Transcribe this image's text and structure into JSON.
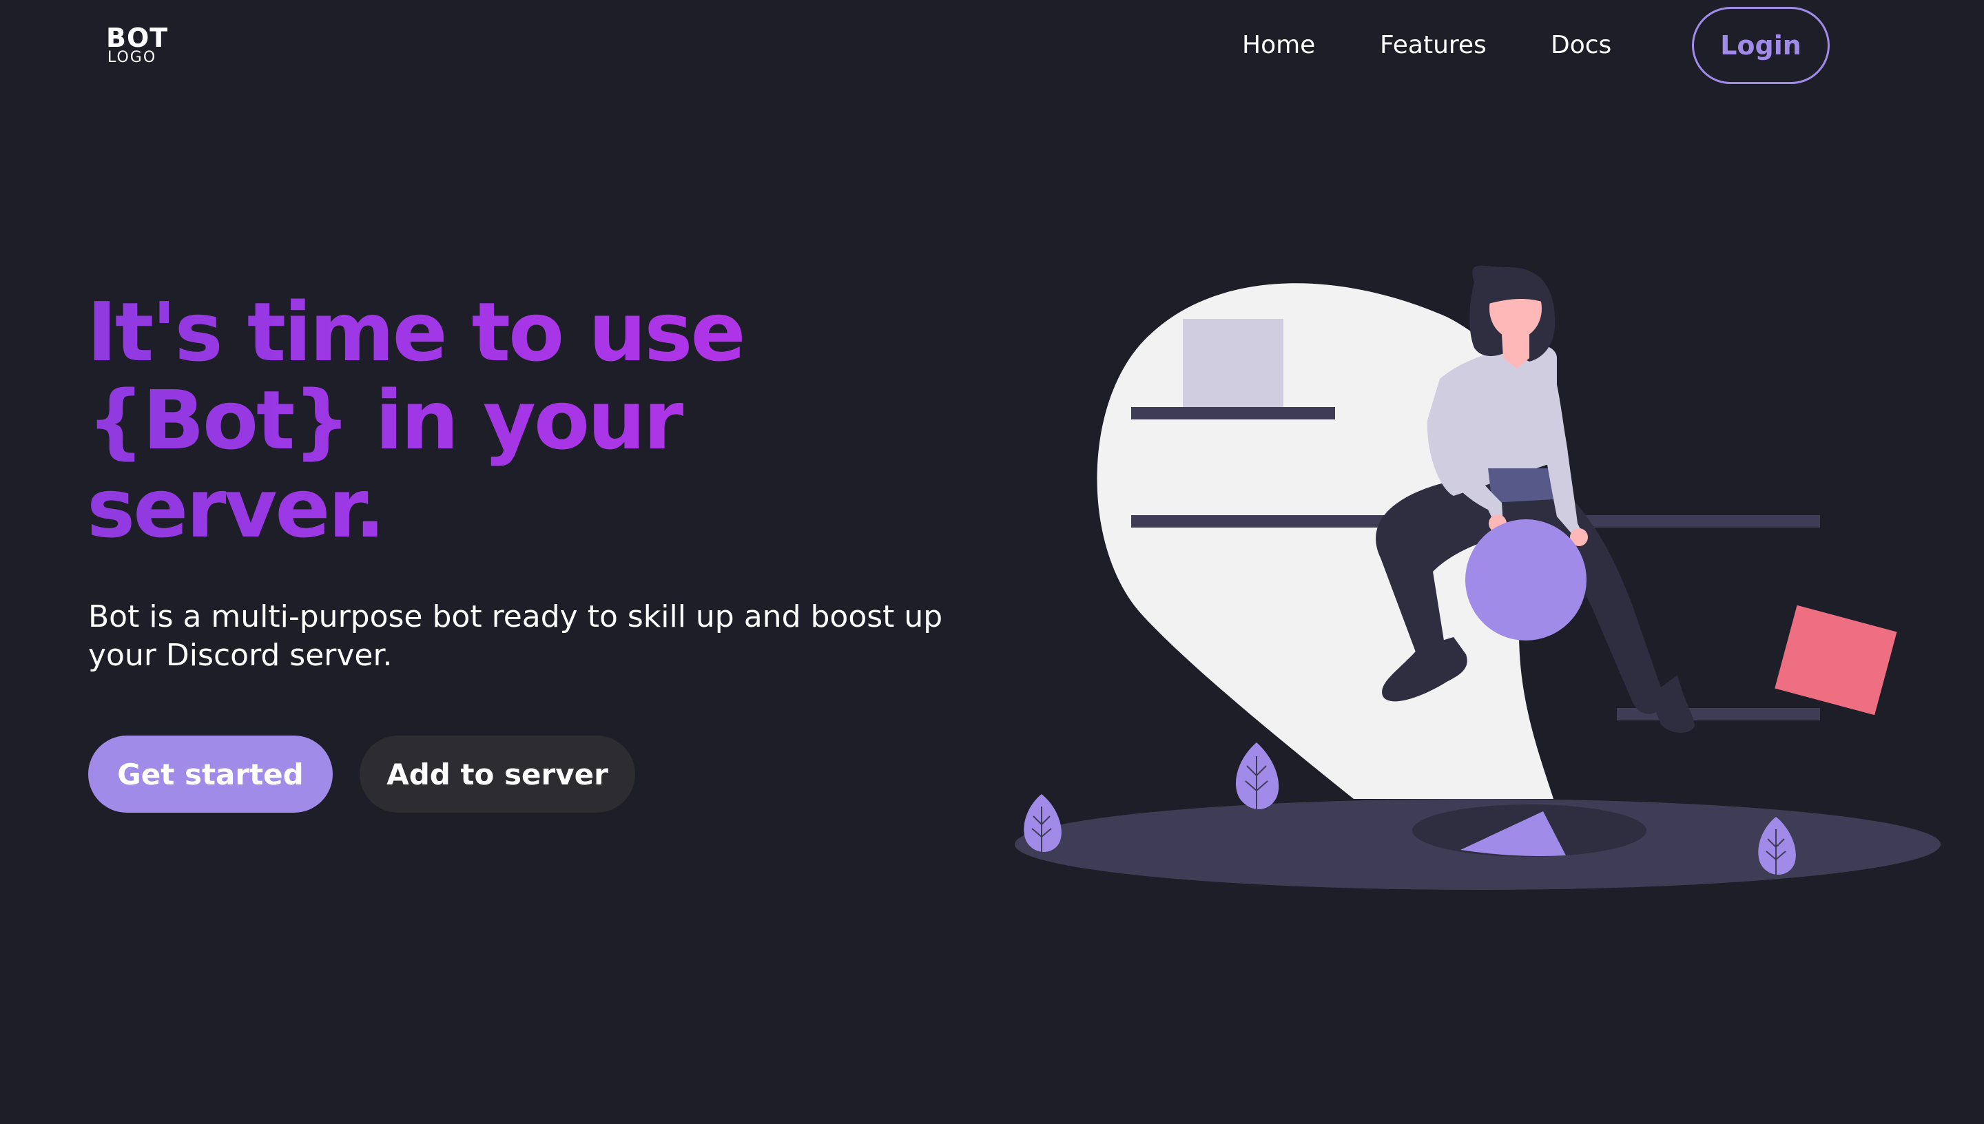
{
  "logo": {
    "main": "BOT",
    "sub": "LOGO"
  },
  "nav": {
    "links": [
      "Home",
      "Features",
      "Docs"
    ],
    "login_label": "Login"
  },
  "hero": {
    "headline_lines": [
      "It's time to use",
      "{Bot} in your",
      "server."
    ],
    "subtext": "Bot is a multi-purpose bot ready to skill up and boost up your Discord server.",
    "primary_button": "Get started",
    "secondary_button": "Add to server"
  },
  "colors": {
    "background": "#1e1e28",
    "accent": "#a08be8",
    "headline_gradient_start": "#8f3ae0",
    "headline_gradient_end": "#b933e8",
    "secondary_button_bg": "#2c2c31",
    "illustration_pink": "#ee6e82"
  },
  "illustration": {
    "icon_name": "woman-sitting-on-map-pin-illustration"
  }
}
